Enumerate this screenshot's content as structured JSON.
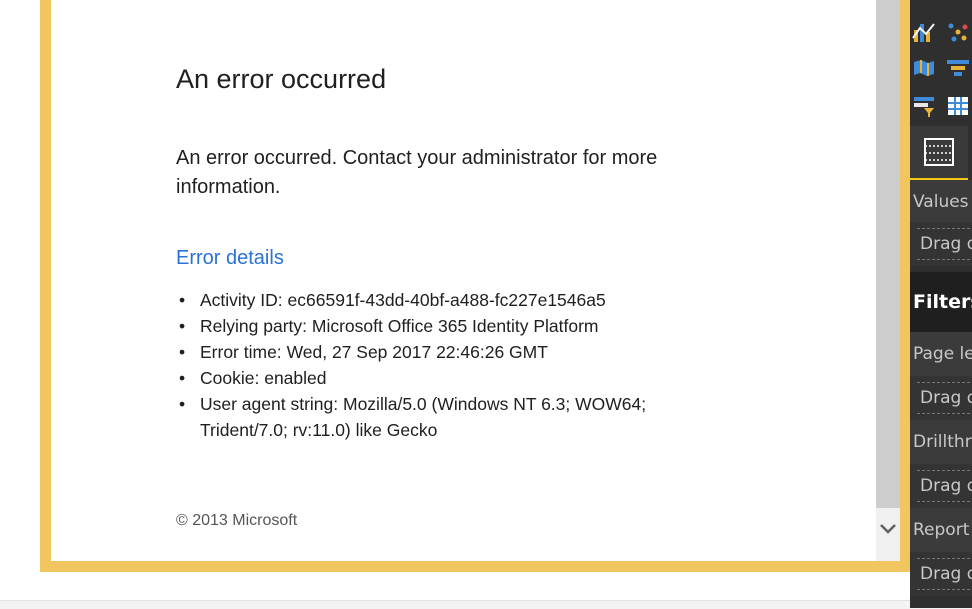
{
  "dialog": {
    "title": "An error occurred",
    "message": "An error occurred. Contact your administrator for more information.",
    "details_link": "Error details",
    "details": [
      {
        "label": "Activity ID:",
        "value": "ec66591f-43dd-40bf-a488-fc227e1546a5"
      },
      {
        "label": "Relying party:",
        "value": "Microsoft Office 365 Identity Platform"
      },
      {
        "label": "Error time:",
        "value": "Wed, 27 Sep 2017 22:46:26 GMT"
      },
      {
        "label": "Cookie:",
        "value": "enabled"
      },
      {
        "label": "User agent string:",
        "value": "Mozilla/5.0 (Windows NT 6.3; WOW64; Trident/7.0; rv:11.0) like Gecko"
      }
    ],
    "copyright": "© 2013 Microsoft",
    "bullet": "•"
  },
  "side_panel": {
    "values_label": "Values",
    "values_drop": "Drag data fields here",
    "filters_heading": "Filters",
    "page_level": "Page level filters",
    "page_drop": "Drag data fields here",
    "drillthrough": "Drillthrough filters",
    "drill_drop": "Drag drillthrough fields here",
    "report_level": "Report level filters",
    "report_drop": "Drag data fields here"
  },
  "colors": {
    "frame": "#f1c660",
    "link": "#2a72d4",
    "accent_underline": "#f2c811",
    "panel": "#2f2f2f"
  }
}
